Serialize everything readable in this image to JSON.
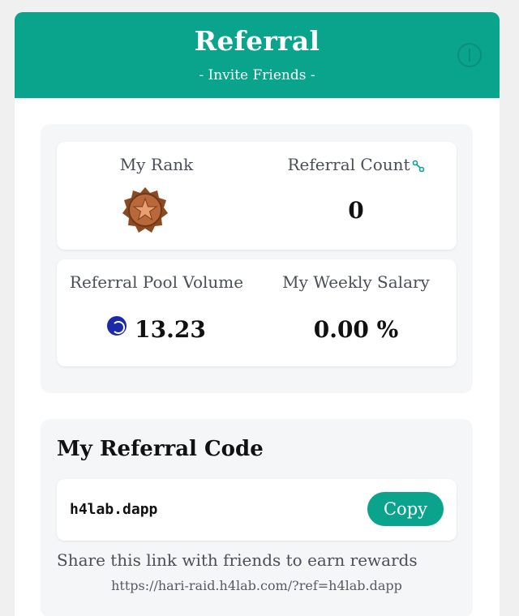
{
  "header": {
    "title": "Referral",
    "subtitle": "- Invite Friends -"
  },
  "stats": {
    "rank": {
      "label": "My Rank",
      "icon": "bronze-star-medal-icon"
    },
    "referral_count": {
      "label": "Referral Count",
      "value": "0",
      "icon": "link-icon"
    },
    "pool_volume": {
      "label": "Referral Pool Volume",
      "value": "13.23",
      "icon": "steem-coin-icon"
    },
    "weekly_salary": {
      "label": "My Weekly Salary",
      "value": "0.00 %"
    }
  },
  "referral_code": {
    "title": "My Referral Code",
    "code": "h4lab.dapp",
    "copy_label": "Copy",
    "share_text": "Share this link with friends to earn rewards",
    "share_link": "https://hari-raid.h4lab.com/?ref=h4lab.dapp"
  },
  "colors": {
    "accent": "#0aa38c",
    "panel_bg": "#f5f6f8",
    "coin": "#1d2aa8",
    "medal": "#a0522d"
  }
}
